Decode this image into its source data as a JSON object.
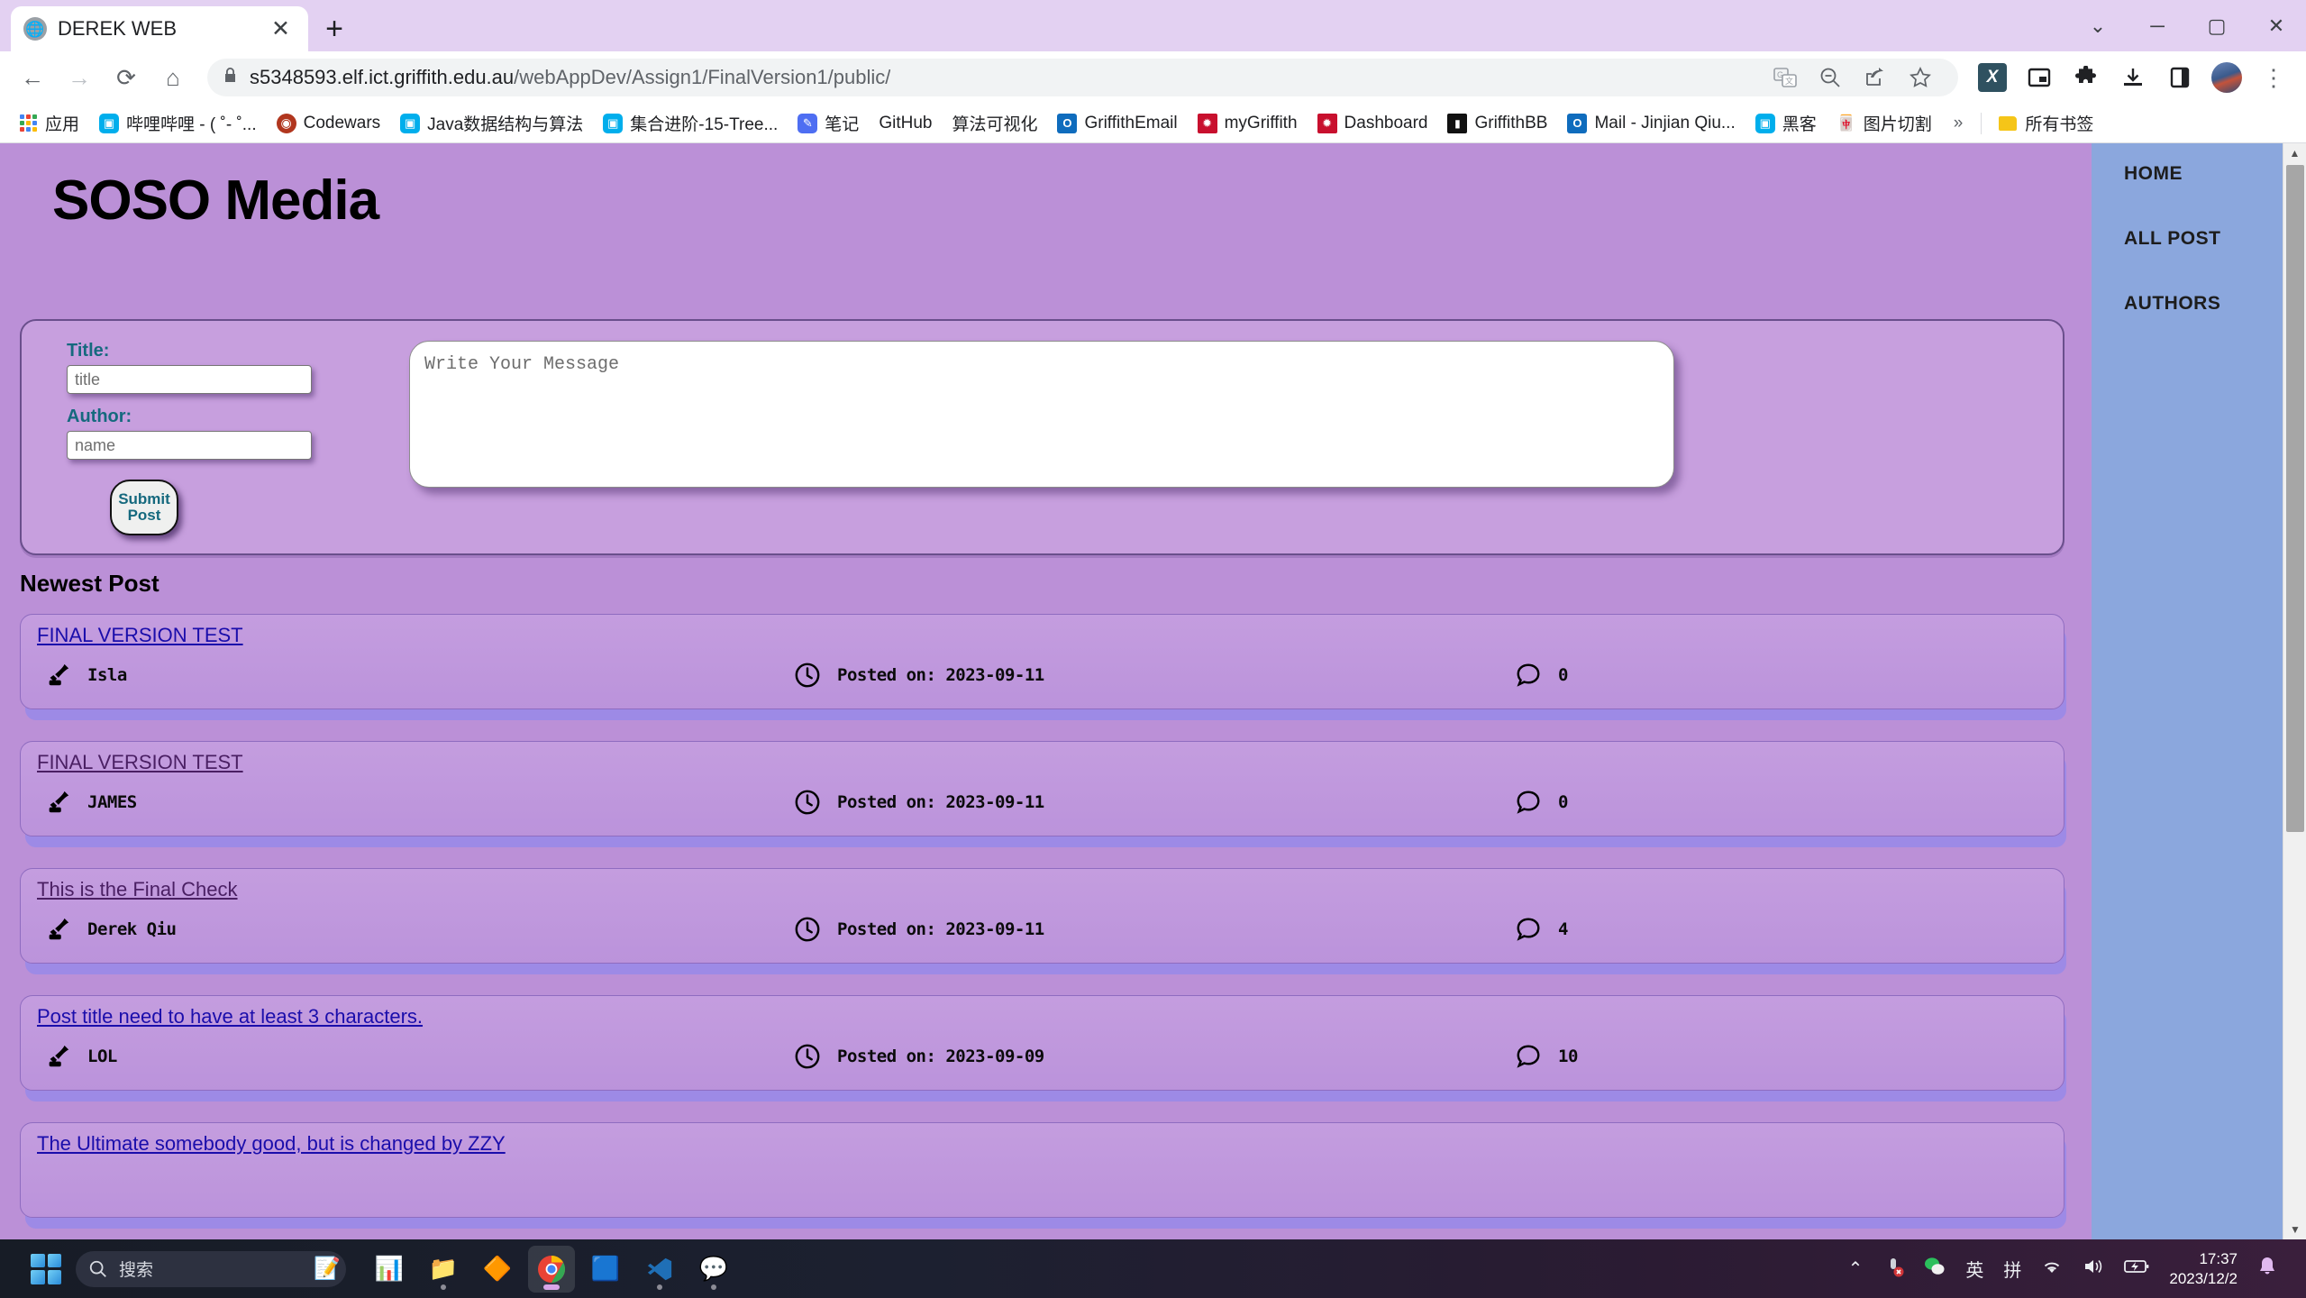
{
  "browser": {
    "tab": {
      "title": "DEREK WEB",
      "favicon": "globe-icon",
      "close": "✕"
    },
    "newtab_label": "+",
    "window_controls": {
      "minimize": "─",
      "maximize": "▢",
      "close": "✕",
      "collapse": "⌄"
    },
    "nav": {
      "back": "←",
      "forward": "→",
      "reload": "⟳",
      "home": "⌂"
    },
    "omnibox": {
      "lock": "🔒",
      "url_host": "s5348593.elf.ict.griffith.edu.au",
      "url_path": "/webAppDev/Assign1/FinalVersion1/public/",
      "translate": "translate-icon",
      "zoom": "zoom-icon",
      "share": "share-icon",
      "bookmark": "star-icon"
    },
    "extensions": {
      "x_badge": "X",
      "pip": "pip-icon",
      "puzzle": "extensions-icon",
      "download": "download-icon",
      "side_panel": "side-panel-icon",
      "menu": "⋮"
    },
    "bookmarks": [
      {
        "label": "应用",
        "icon": "apps-grid"
      },
      {
        "label": "哔哩哔哩 - ( ˚- ˚...",
        "icon": "bilibili"
      },
      {
        "label": "Codewars",
        "icon": "codewars"
      },
      {
        "label": "Java数据结构与算法",
        "icon": "bilibili"
      },
      {
        "label": "集合进阶-15-Tree...",
        "icon": "bilibili"
      },
      {
        "label": "笔记",
        "icon": "note"
      },
      {
        "label": "GitHub",
        "icon": "none"
      },
      {
        "label": "算法可视化",
        "icon": "none"
      },
      {
        "label": "GriffithEmail",
        "icon": "outlook"
      },
      {
        "label": "myGriffith",
        "icon": "griffith"
      },
      {
        "label": "Dashboard",
        "icon": "griffith"
      },
      {
        "label": "GriffithBB",
        "icon": "bb"
      },
      {
        "label": "Mail - Jinjian Qiu...",
        "icon": "outlook"
      },
      {
        "label": "黑客",
        "icon": "bilibili"
      },
      {
        "label": "图片切割",
        "icon": "hack"
      }
    ],
    "bookmarks_overflow": "»",
    "all_bookmarks": "所有书签"
  },
  "site": {
    "title": "SOSO Media",
    "nav": [
      {
        "label": "HOME"
      },
      {
        "label": "ALL POST"
      },
      {
        "label": "AUTHORS"
      }
    ],
    "form": {
      "title_label": "Title:",
      "title_placeholder": "title",
      "title_value": "",
      "author_label": "Author:",
      "author_placeholder": "name",
      "author_value": "",
      "submit_label": "Submit Post",
      "message_placeholder": "Write Your Message",
      "message_value": ""
    },
    "section_heading": "Newest Post",
    "date_prefix": "Posted on: ",
    "posts": [
      {
        "title": "FINAL VERSION TEST",
        "author": "Isla",
        "date": "Posted on: 2023-09-11",
        "comments": "0",
        "visited": false
      },
      {
        "title": "FINAL VERSION TEST",
        "author": "JAMES",
        "date": "Posted on: 2023-09-11",
        "comments": "0",
        "visited": true
      },
      {
        "title": "This is the Final Check",
        "author": "Derek Qiu",
        "date": "Posted on: 2023-09-11",
        "comments": "4",
        "visited": true
      },
      {
        "title": "Post title need to have at least 3 characters.",
        "author": "LOL",
        "date": "Posted on: 2023-09-09",
        "comments": "10",
        "visited": false
      },
      {
        "title": "The Ultimate somebody good, but is changed by ZZY",
        "author": "",
        "date": "",
        "comments": "",
        "visited": false
      }
    ],
    "colors": {
      "page_bg": "#bb90d7",
      "rail_bg": "#8ba7dd",
      "card_bg": "#c79fde",
      "label_teal": "#15697e",
      "link": "#1a0dab",
      "link_visited": "#4a1f63",
      "card_shadow": "#9d8ae6"
    }
  },
  "taskbar": {
    "search_placeholder": "搜索",
    "apps": [
      {
        "name": "start"
      },
      {
        "name": "powerpoint"
      },
      {
        "name": "file-explorer"
      },
      {
        "name": "unity"
      },
      {
        "name": "chrome"
      },
      {
        "name": "teams"
      },
      {
        "name": "vscode"
      },
      {
        "name": "wechat"
      }
    ],
    "tray": {
      "chevron": "⌃",
      "mic_muted": "mic-muted-icon",
      "wechat": "wechat-icon",
      "ime_lang": "英",
      "ime_mode": "拼",
      "wifi": "wifi-icon",
      "volume": "volume-icon",
      "battery": "battery-icon",
      "time": "17:37",
      "date": "2023/12/2",
      "bell": "notification-bell-icon"
    }
  }
}
